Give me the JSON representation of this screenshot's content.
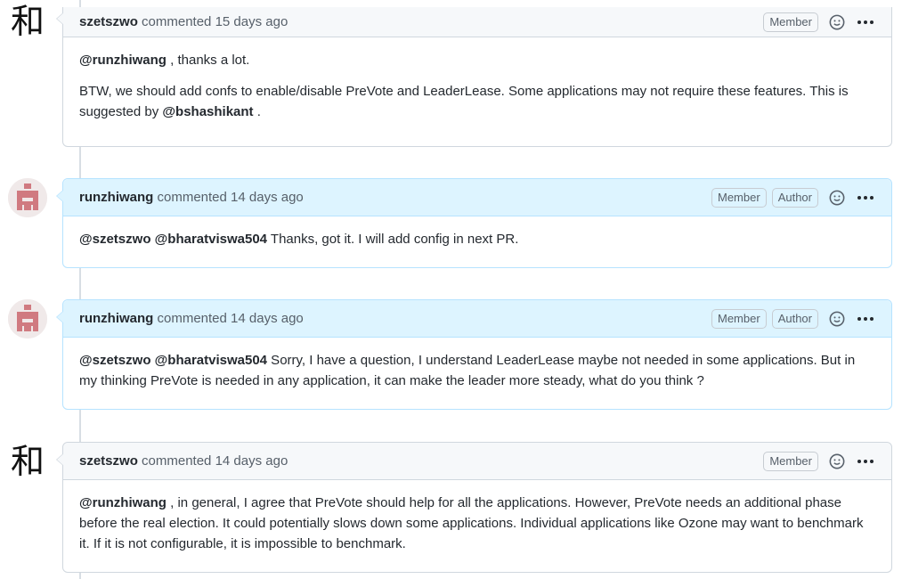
{
  "comments": [
    {
      "author": "szetszwo",
      "action": "commented",
      "time": "15 days ago",
      "badges": [
        "Member"
      ],
      "paragraphs": [
        [
          {
            "mention": "@runzhiwang"
          },
          {
            "text": " , thanks a lot."
          }
        ],
        [
          {
            "text": "BTW, we should add confs to enable/disable PreVote and LeaderLease. Some applications may not require these features. This is suggested by "
          },
          {
            "mention": "@bshashikant"
          },
          {
            "text": " ."
          }
        ]
      ]
    },
    {
      "author": "runzhiwang",
      "action": "commented",
      "time": "14 days ago",
      "badges": [
        "Member",
        "Author"
      ],
      "paragraphs": [
        [
          {
            "mention": "@szetszwo"
          },
          {
            "text": " "
          },
          {
            "mention": "@bharatviswa504"
          },
          {
            "text": " Thanks, got it. I will add config in next PR."
          }
        ]
      ]
    },
    {
      "author": "runzhiwang",
      "action": "commented",
      "time": "14 days ago",
      "badges": [
        "Member",
        "Author"
      ],
      "paragraphs": [
        [
          {
            "mention": "@szetszwo"
          },
          {
            "text": " "
          },
          {
            "mention": "@bharatviswa504"
          },
          {
            "text": " Sorry, I have a question, I understand LeaderLease maybe not needed in some applications. But in my thinking PreVote is needed in any application, it can make the leader more steady, what do you think ?"
          }
        ]
      ]
    },
    {
      "author": "szetszwo",
      "action": "commented",
      "time": "14 days ago",
      "badges": [
        "Member"
      ],
      "paragraphs": [
        [
          {
            "mention": "@runzhiwang"
          },
          {
            "text": " , in general, I agree that PreVote should help for all the applications. However, PreVote needs an additional phase before the real election. It could potentially slows down some applications. Individual applications like Ozone may want to benchmark it. If it is not configurable, it is impossible to benchmark."
          }
        ]
      ]
    }
  ],
  "avatars": {
    "szetszwo": {
      "glyph": "和"
    }
  },
  "colors": {
    "identicon": "#d07a80",
    "author_header": "#ddf4ff",
    "header": "#f6f8fa",
    "border": "#d0d7de"
  },
  "icons": {
    "reaction": "smiley-icon",
    "menu": "kebab-horizontal-icon"
  }
}
